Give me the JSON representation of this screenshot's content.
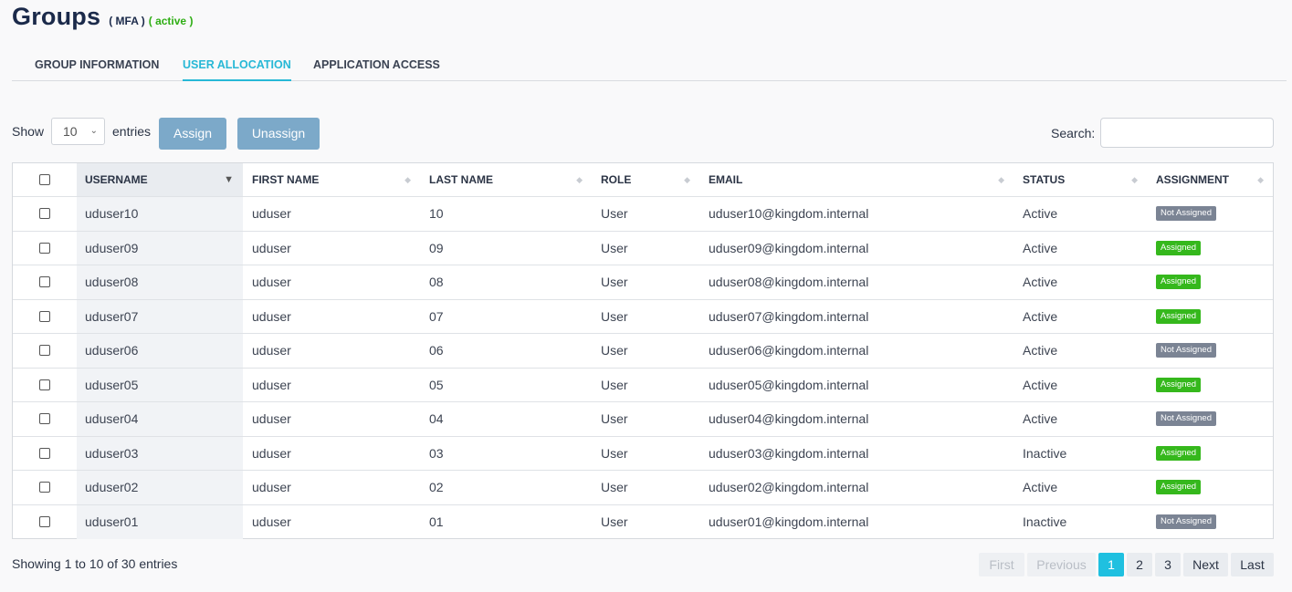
{
  "header": {
    "title": "Groups",
    "mfa": "( MFA )",
    "status": "( active )"
  },
  "tabs": [
    {
      "label": "GROUP INFORMATION",
      "active": false
    },
    {
      "label": "USER ALLOCATION",
      "active": true
    },
    {
      "label": "APPLICATION ACCESS",
      "active": false
    }
  ],
  "controls": {
    "show_label": "Show",
    "entries_value": "10",
    "entries_label": "entries",
    "assign_label": "Assign",
    "unassign_label": "Unassign",
    "search_label": "Search:",
    "search_value": ""
  },
  "table": {
    "columns": [
      "USERNAME",
      "FIRST NAME",
      "LAST NAME",
      "ROLE",
      "EMAIL",
      "STATUS",
      "ASSIGNMENT"
    ],
    "sorted_column": "USERNAME",
    "rows": [
      {
        "username": "uduser10",
        "first_name": "uduser",
        "last_name": "10",
        "role": "User",
        "email": "uduser10@kingdom.internal",
        "status": "Active",
        "assignment": "Not Assigned"
      },
      {
        "username": "uduser09",
        "first_name": "uduser",
        "last_name": "09",
        "role": "User",
        "email": "uduser09@kingdom.internal",
        "status": "Active",
        "assignment": "Assigned"
      },
      {
        "username": "uduser08",
        "first_name": "uduser",
        "last_name": "08",
        "role": "User",
        "email": "uduser08@kingdom.internal",
        "status": "Active",
        "assignment": "Assigned"
      },
      {
        "username": "uduser07",
        "first_name": "uduser",
        "last_name": "07",
        "role": "User",
        "email": "uduser07@kingdom.internal",
        "status": "Active",
        "assignment": "Assigned"
      },
      {
        "username": "uduser06",
        "first_name": "uduser",
        "last_name": "06",
        "role": "User",
        "email": "uduser06@kingdom.internal",
        "status": "Active",
        "assignment": "Not Assigned"
      },
      {
        "username": "uduser05",
        "first_name": "uduser",
        "last_name": "05",
        "role": "User",
        "email": "uduser05@kingdom.internal",
        "status": "Active",
        "assignment": "Assigned"
      },
      {
        "username": "uduser04",
        "first_name": "uduser",
        "last_name": "04",
        "role": "User",
        "email": "uduser04@kingdom.internal",
        "status": "Active",
        "assignment": "Not Assigned"
      },
      {
        "username": "uduser03",
        "first_name": "uduser",
        "last_name": "03",
        "role": "User",
        "email": "uduser03@kingdom.internal",
        "status": "Inactive",
        "assignment": "Assigned"
      },
      {
        "username": "uduser02",
        "first_name": "uduser",
        "last_name": "02",
        "role": "User",
        "email": "uduser02@kingdom.internal",
        "status": "Active",
        "assignment": "Assigned"
      },
      {
        "username": "uduser01",
        "first_name": "uduser",
        "last_name": "01",
        "role": "User",
        "email": "uduser01@kingdom.internal",
        "status": "Inactive",
        "assignment": "Not Assigned"
      }
    ]
  },
  "footer": {
    "info": "Showing 1 to 10 of 30 entries",
    "pagination": {
      "first": "First",
      "previous": "Previous",
      "pages": [
        "1",
        "2",
        "3"
      ],
      "current": "1",
      "next": "Next",
      "last": "Last"
    }
  },
  "colors": {
    "accent": "#27b8d6",
    "assigned": "#35b81c",
    "not_assigned": "#7b8494",
    "button": "#7ca9c9"
  }
}
